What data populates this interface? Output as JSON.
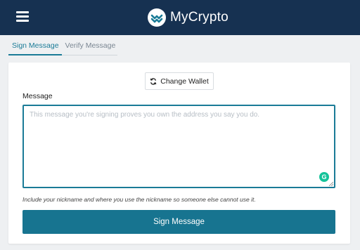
{
  "header": {
    "brand_name": "MyCrypto",
    "menu_icon": "hamburger-menu-icon",
    "logo_icon": "mycrypto-logo-icon",
    "background_color": "#163151"
  },
  "tabs": [
    {
      "label": "Sign Message",
      "active": true
    },
    {
      "label": "Verify Message",
      "active": false
    }
  ],
  "sign": {
    "change_wallet_label": "Change Wallet",
    "change_wallet_icon": "refresh-icon",
    "message_label": "Message",
    "message_value": "",
    "message_placeholder": "This message you're signing proves you own the address you say you do.",
    "hint": "Include your nickname and where you use the nickname so someone else cannot use it.",
    "submit_label": "Sign Message",
    "accent_color": "#177490"
  }
}
